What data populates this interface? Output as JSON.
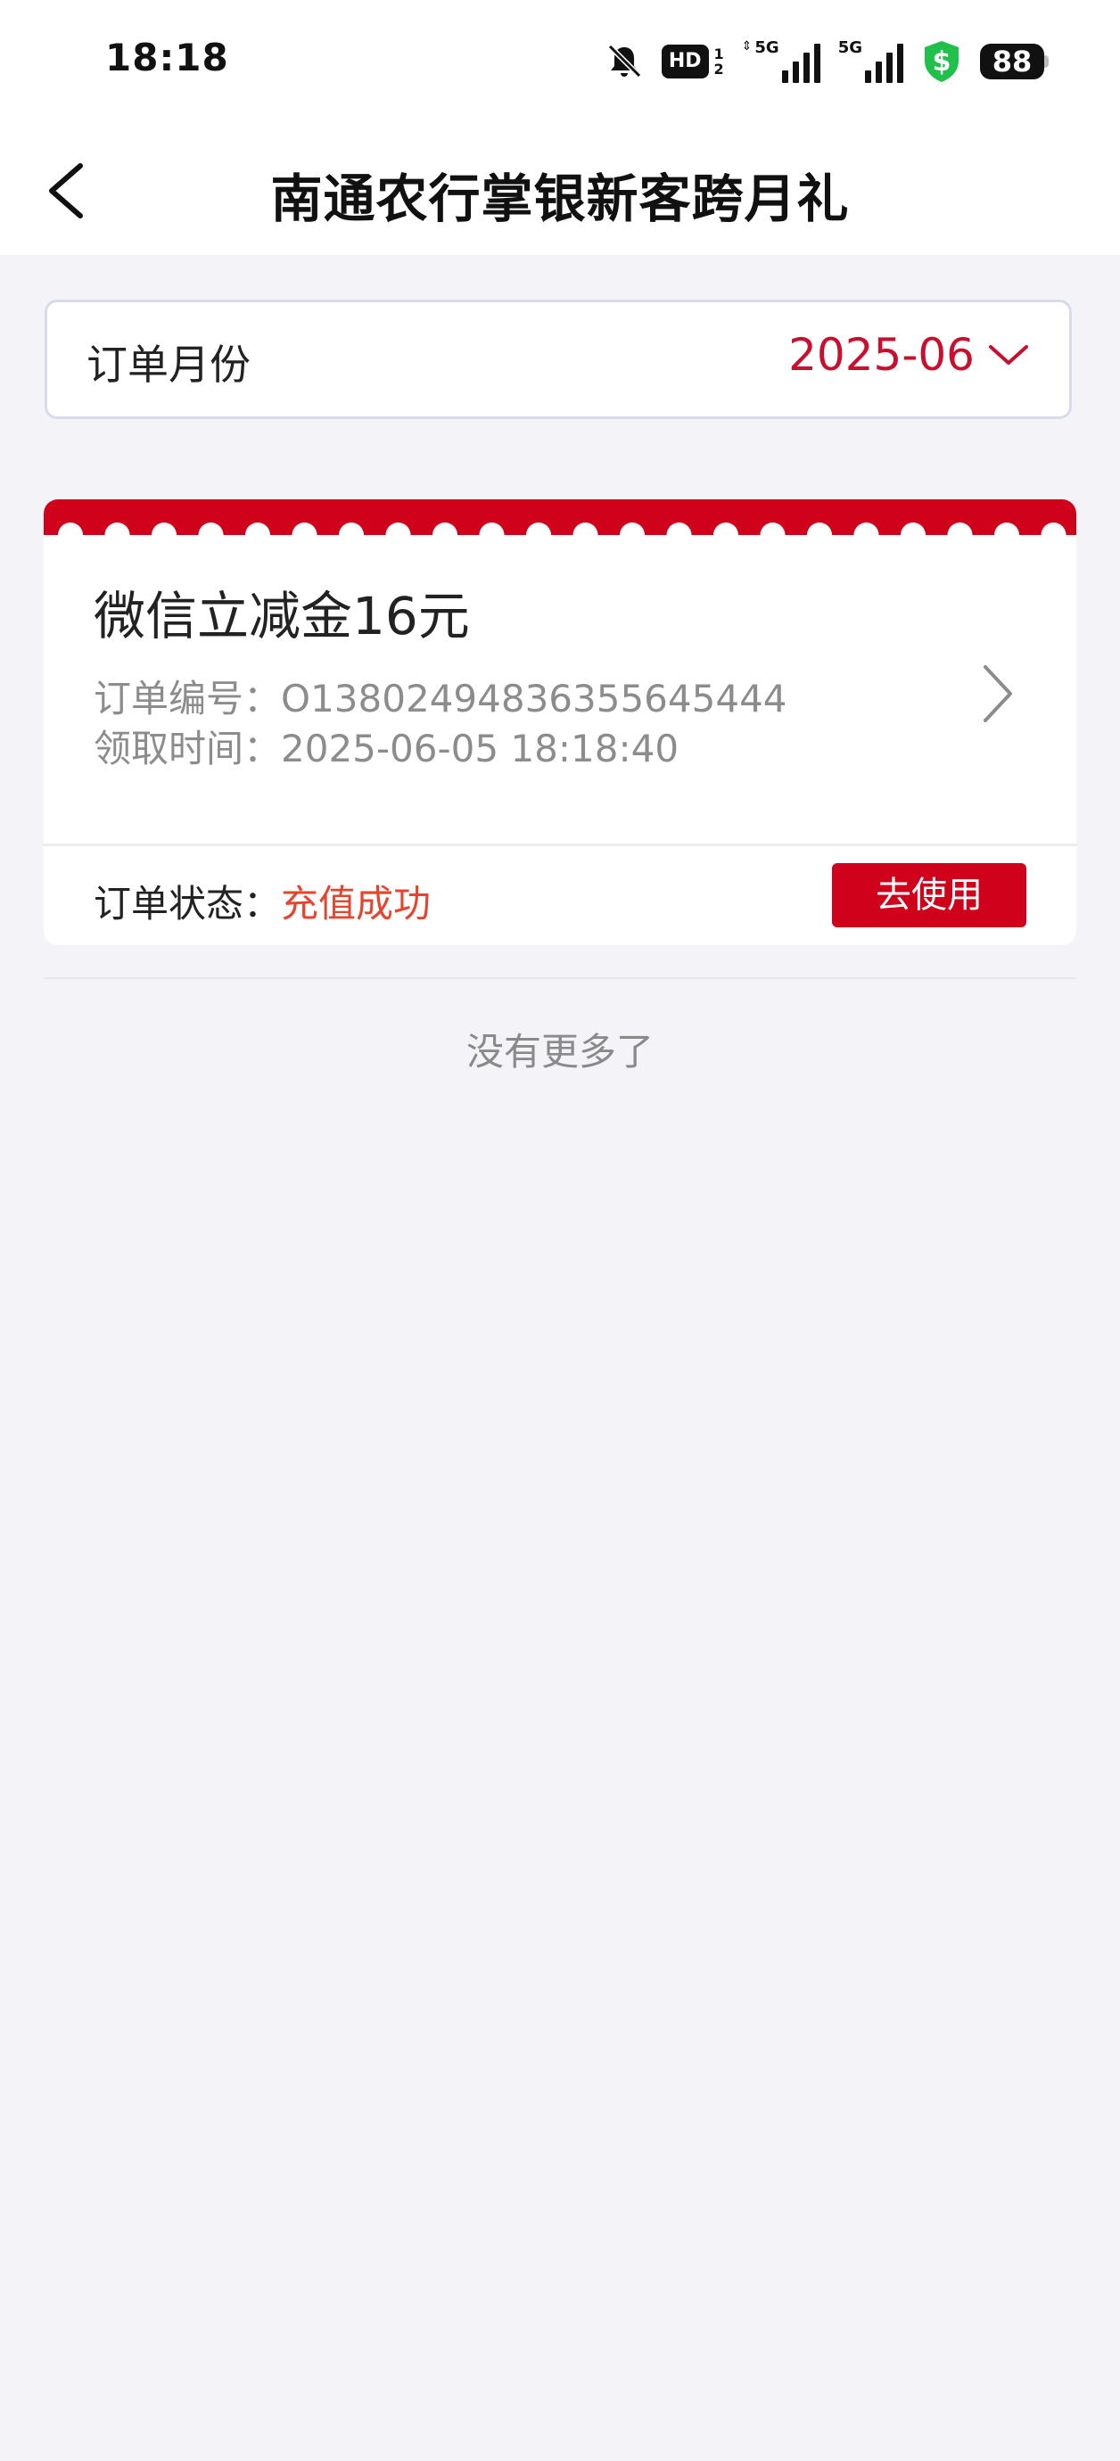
{
  "status_bar": {
    "time": "18:18",
    "hd": "HD",
    "sim_top": "1",
    "sim_bottom": "2",
    "net1": "5G",
    "net2": "5G",
    "battery": "88"
  },
  "header": {
    "title": "南通农行掌银新客跨月礼"
  },
  "filter": {
    "label": "订单月份",
    "month": "2025-06"
  },
  "order": {
    "title": "微信立减金16元",
    "order_no_label": "订单编号：",
    "order_no": "O13802494836355645444",
    "time_label": "领取时间：",
    "time": "2025-06-05 18:18:40",
    "status_label": "订单状态：",
    "status": "充值成功",
    "use_button": "去使用"
  },
  "footer": {
    "no_more": "没有更多了"
  },
  "colors": {
    "accent": "#c8102e",
    "button": "#d0021b",
    "status_success": "#e5452f",
    "background": "#f3f3f8",
    "vpn_shield": "#1fc14b"
  }
}
